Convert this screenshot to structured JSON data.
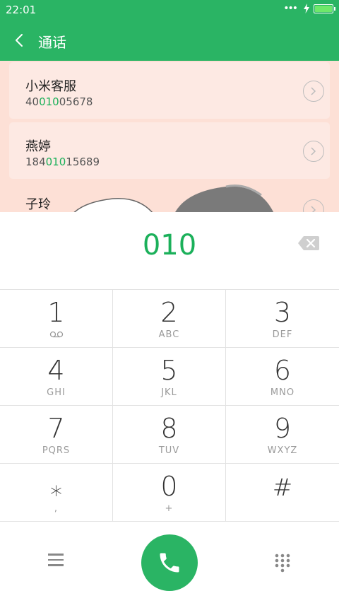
{
  "status_bar": {
    "time": "22:01",
    "battery_color": "#6ee86a"
  },
  "app_bar": {
    "title": "通话",
    "background": "#2ab464"
  },
  "contacts": [
    {
      "name": "小米客服",
      "number_pre": "40",
      "number_match": "010",
      "number_post": "05678"
    },
    {
      "name": "燕婷",
      "number_pre": "184",
      "number_match": "010",
      "number_post": "15689"
    },
    {
      "name": "子玲"
    }
  ],
  "dialer": {
    "input_value": "010",
    "accent_color": "#1bb05a",
    "keys": [
      {
        "digit": "1",
        "sub_icon": "voicemail-icon"
      },
      {
        "digit": "2",
        "sub": "ABC"
      },
      {
        "digit": "3",
        "sub": "DEF"
      },
      {
        "digit": "4",
        "sub": "GHI"
      },
      {
        "digit": "5",
        "sub": "JKL"
      },
      {
        "digit": "6",
        "sub": "MNO"
      },
      {
        "digit": "7",
        "sub": "PQRS"
      },
      {
        "digit": "8",
        "sub": "TUV"
      },
      {
        "digit": "9",
        "sub": "WXYZ"
      },
      {
        "digit": "⁎",
        "sub": ","
      },
      {
        "digit": "0",
        "sub": "+"
      },
      {
        "digit": "#",
        "sub": ""
      }
    ]
  },
  "bottom_bar": {
    "left_icon": "menu-icon",
    "center_icon": "phone-icon",
    "right_icon": "dialpad-icon"
  }
}
